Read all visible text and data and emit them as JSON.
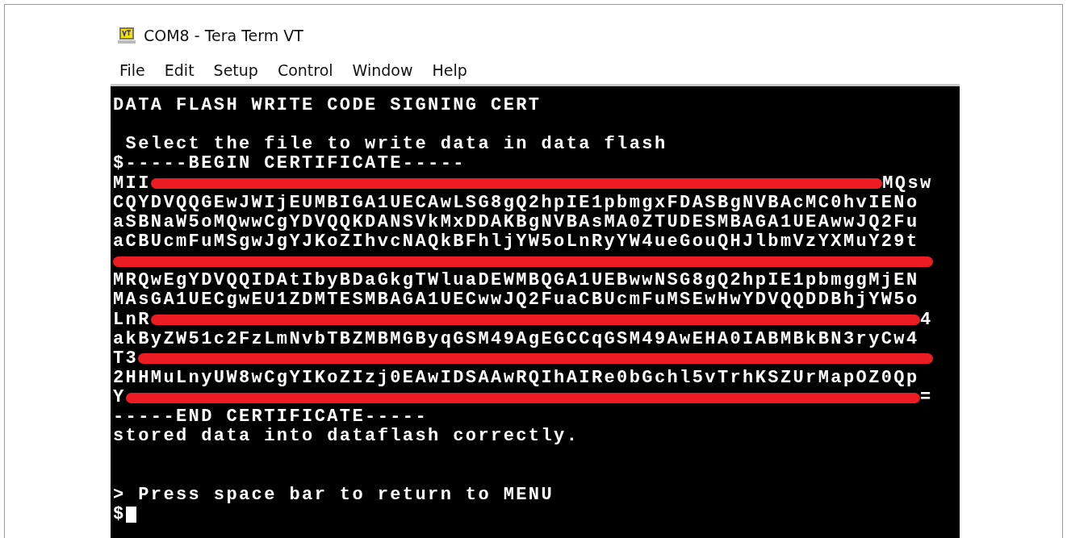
{
  "window": {
    "title": "COM8 - Tera Term VT"
  },
  "menu": [
    {
      "label": "File"
    },
    {
      "label": "Edit"
    },
    {
      "label": "Setup"
    },
    {
      "label": "Control"
    },
    {
      "label": "Window"
    },
    {
      "label": "Help"
    }
  ],
  "terminal": {
    "lines": [
      {
        "kind": "text",
        "text": "DATA FLASH WRITE CODE SIGNING CERT"
      },
      {
        "kind": "blank"
      },
      {
        "kind": "text",
        "text": " Select the file to write data in data flash"
      },
      {
        "kind": "text",
        "text": "$-----BEGIN CERTIFICATE-----"
      },
      {
        "kind": "redacted",
        "start": "MII",
        "end": "MQsw"
      },
      {
        "kind": "text",
        "text": "CQYDVQQGEwJWIjEUMBIGA1UECAwLSG8gQ2hpIE1pbmgxFDASBgNVBAcMC0hvIENo"
      },
      {
        "kind": "text",
        "text": "aSBNaW5oMQwwCgYDVQQKDANSVkMxDDAKBgNVBAsMA0ZTUDESMBAGA1UEAwwJQ2Fu"
      },
      {
        "kind": "text",
        "text": "aCBUcmFuMSgwJgYJKoZIhvcNAQkBFhljYW5oLnRyYW4ueGouQHJlbmVzYXMuY29t"
      },
      {
        "kind": "redacted"
      },
      {
        "kind": "text",
        "text": "MRQwEgYDVQQIDAtIbyBDaGkgTWluaDEWMBQGA1UEBwwNSG8gQ2hpIE1pbmggMjEN"
      },
      {
        "kind": "text",
        "text": "MAsGA1UECgwEU1ZDMTESMBAGA1UECwwJQ2FuaCBUcmFuMSEwHwYDVQQDDBhjYW5o"
      },
      {
        "kind": "redacted",
        "start": "LnR",
        "end": "4"
      },
      {
        "kind": "text",
        "text": "akByZW51c2FzLmNvbTBZMBMGByqGSM49AgEGCCqGSM49AwEHA0IABMBkBN3ryCw4"
      },
      {
        "kind": "redacted",
        "start": "T3"
      },
      {
        "kind": "text",
        "text": "2HHMuLnyUW8wCgYIKoZIzj0EAwIDSAAwRQIhAIRe0bGchl5vTrhKSZUrMapOZ0Qp"
      },
      {
        "kind": "redacted",
        "start": "Y",
        "end": "="
      },
      {
        "kind": "text",
        "text": "-----END CERTIFICATE-----"
      },
      {
        "kind": "text",
        "text": "stored data into dataflash correctly."
      },
      {
        "kind": "blank"
      },
      {
        "kind": "blank"
      },
      {
        "kind": "text",
        "text": "> Press space bar to return to MENU"
      },
      {
        "kind": "cursor",
        "text": "$"
      }
    ]
  }
}
